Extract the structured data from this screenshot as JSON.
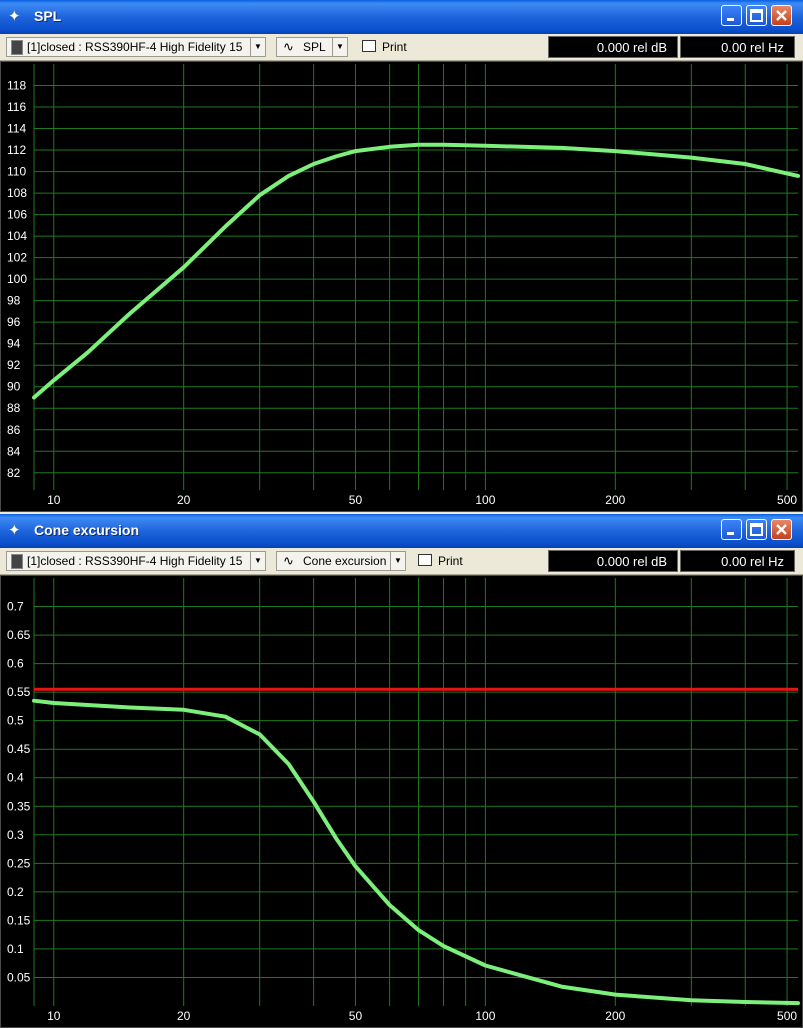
{
  "windows": [
    {
      "title": "SPL",
      "curve_select": "[1]closed : RSS390HF-4 High Fidelity 15",
      "plot_select": "SPL",
      "print_label": "Print",
      "readout_db": "0.000 rel dB",
      "readout_hz": "0.00 rel Hz"
    },
    {
      "title": "Cone excursion",
      "curve_select": "[1]closed : RSS390HF-4 High Fidelity 15",
      "plot_select": "Cone excursion",
      "print_label": "Print",
      "readout_db": "0.000 rel dB",
      "readout_hz": "0.00 rel Hz"
    }
  ],
  "colors": {
    "curve": "#7CF07A",
    "limit_line": "#E81414",
    "grid": "#1E7A1E",
    "background": "#000000"
  },
  "chart_data": [
    {
      "type": "line",
      "xscale": "log",
      "xlim": [
        9,
        530
      ],
      "ylim": [
        80.4,
        120
      ],
      "x_ticks": [
        10,
        20,
        50,
        100,
        200,
        500
      ],
      "y_ticks": [
        82,
        84,
        86,
        88,
        90,
        92,
        94,
        96,
        98,
        100,
        102,
        104,
        106,
        108,
        110,
        112,
        114,
        116,
        118
      ],
      "grid": true,
      "series": [
        {
          "x": [
            9,
            10,
            12,
            15,
            20,
            25,
            30,
            35,
            40,
            45,
            50,
            60,
            70,
            80,
            100,
            150,
            200,
            300,
            400,
            530
          ],
          "y": [
            89.0,
            90.6,
            93.2,
            96.8,
            101.1,
            104.9,
            107.8,
            109.6,
            110.7,
            111.4,
            111.9,
            112.3,
            112.5,
            112.5,
            112.4,
            112.2,
            111.9,
            111.3,
            110.7,
            109.6
          ]
        }
      ]
    },
    {
      "type": "line",
      "xscale": "log",
      "xlim": [
        9,
        530
      ],
      "ylim": [
        0,
        0.75
      ],
      "x_ticks": [
        10,
        20,
        50,
        100,
        200,
        500
      ],
      "y_ticks": [
        0.05,
        0.1,
        0.15,
        0.2,
        0.25,
        0.3,
        0.35,
        0.4,
        0.45,
        0.5,
        0.55,
        0.6,
        0.65,
        0.7
      ],
      "grid": true,
      "limit_line": 0.555,
      "series": [
        {
          "x": [
            9,
            10,
            15,
            20,
            25,
            30,
            35,
            40,
            45,
            50,
            60,
            70,
            80,
            100,
            150,
            200,
            300,
            400,
            530
          ],
          "y": [
            0.535,
            0.531,
            0.523,
            0.519,
            0.507,
            0.476,
            0.424,
            0.358,
            0.295,
            0.245,
            0.177,
            0.133,
            0.105,
            0.071,
            0.034,
            0.02,
            0.01,
            0.007,
            0.005
          ]
        }
      ]
    }
  ]
}
